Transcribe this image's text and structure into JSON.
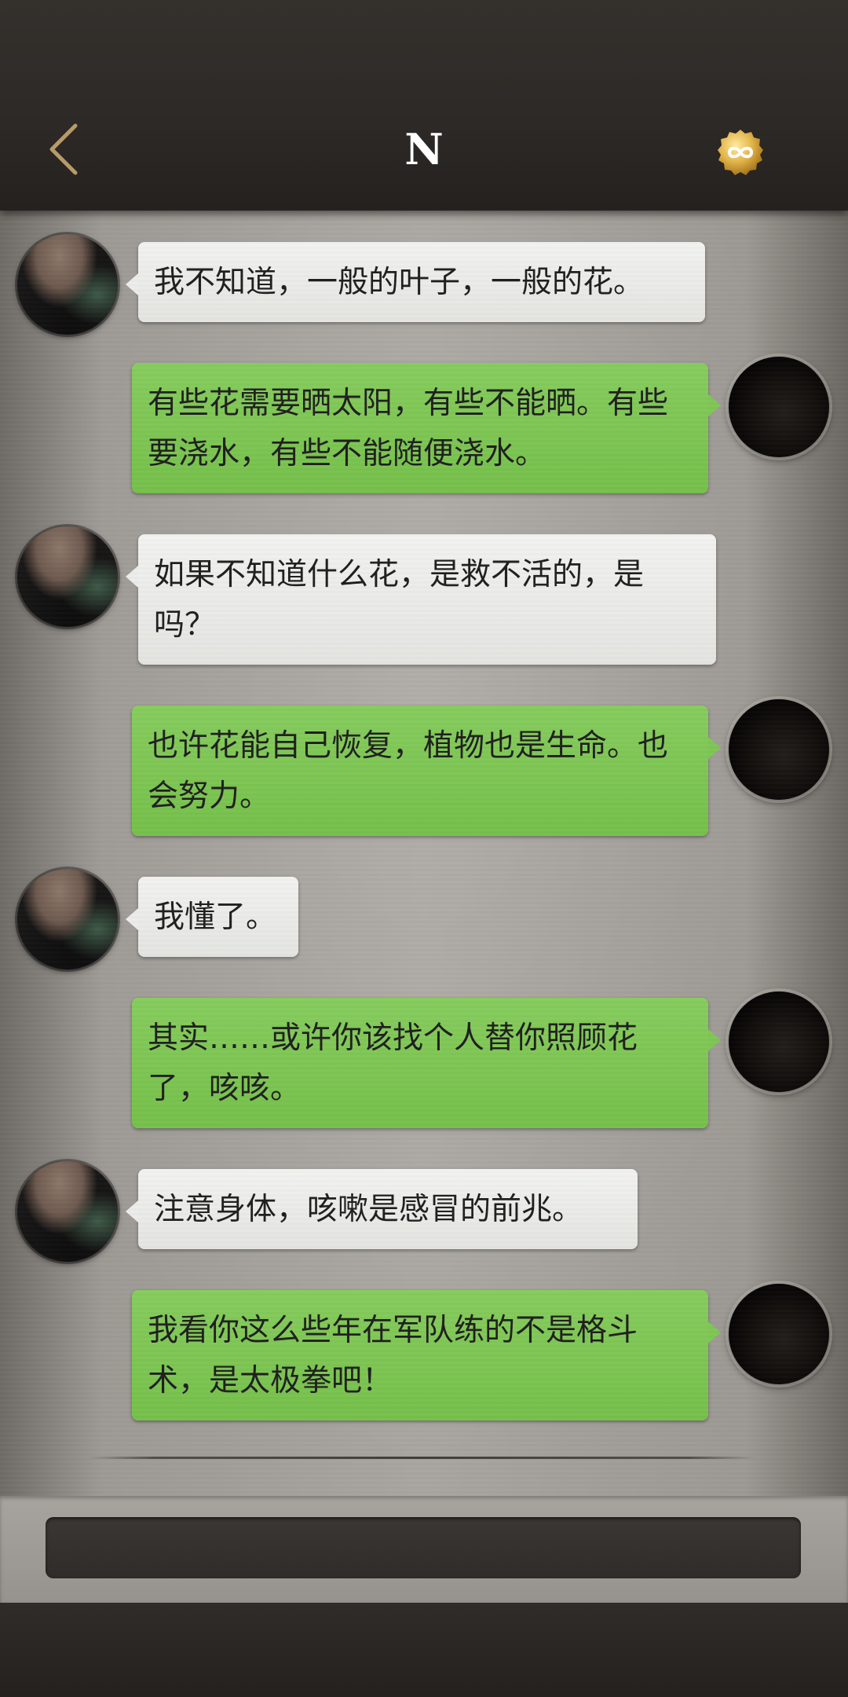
{
  "header": {
    "title": "N",
    "back_icon": "chevron-left-icon",
    "badge_icon": "infinity-coin-icon",
    "accent_color": "#b89a6a"
  },
  "messages": [
    {
      "side": "in",
      "text": "我不知道，一般的叶子，一般的花。"
    },
    {
      "side": "out",
      "text": "有些花需要晒太阳，有些不能晒。有些要浇水，有些不能随便浇水。"
    },
    {
      "side": "in",
      "text": "如果不知道什么花，是救不活的，是吗？"
    },
    {
      "side": "out",
      "text": "也许花能自己恢复，植物也是生命。也会努力。"
    },
    {
      "side": "in",
      "text": "我懂了。"
    },
    {
      "side": "out",
      "text": "其实……或许你该找个人替你照顾花了，咳咳。"
    },
    {
      "side": "in",
      "text": "注意身体，咳嗽是感冒的前兆。"
    },
    {
      "side": "out",
      "text": "我看你这么些年在军队练的不是格斗术，是太极拳吧！"
    }
  ],
  "input": {
    "value": "",
    "placeholder": ""
  },
  "colors": {
    "outgoing_bubble": "#7fc655",
    "incoming_bubble": "#ececea",
    "header_bg": "#2c2926"
  }
}
